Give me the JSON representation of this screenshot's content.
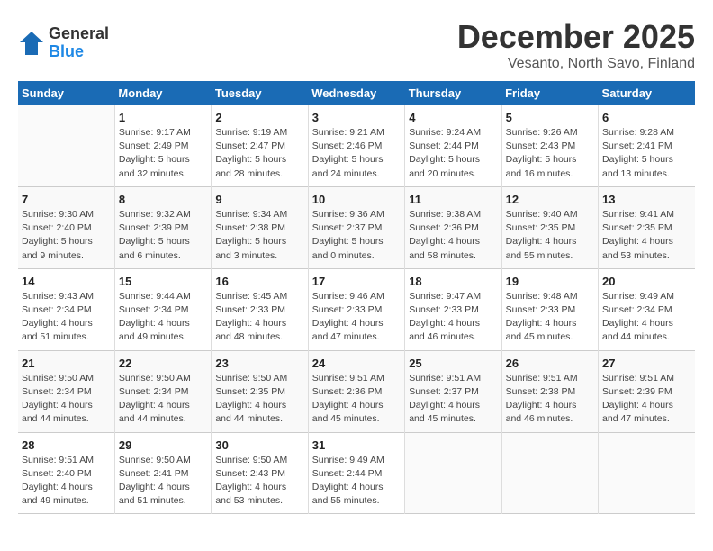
{
  "header": {
    "logo_general": "General",
    "logo_blue": "Blue",
    "month_title": "December 2025",
    "location": "Vesanto, North Savo, Finland"
  },
  "weekdays": [
    "Sunday",
    "Monday",
    "Tuesday",
    "Wednesday",
    "Thursday",
    "Friday",
    "Saturday"
  ],
  "weeks": [
    [
      {
        "day": "",
        "info": ""
      },
      {
        "day": "1",
        "info": "Sunrise: 9:17 AM\nSunset: 2:49 PM\nDaylight: 5 hours\nand 32 minutes."
      },
      {
        "day": "2",
        "info": "Sunrise: 9:19 AM\nSunset: 2:47 PM\nDaylight: 5 hours\nand 28 minutes."
      },
      {
        "day": "3",
        "info": "Sunrise: 9:21 AM\nSunset: 2:46 PM\nDaylight: 5 hours\nand 24 minutes."
      },
      {
        "day": "4",
        "info": "Sunrise: 9:24 AM\nSunset: 2:44 PM\nDaylight: 5 hours\nand 20 minutes."
      },
      {
        "day": "5",
        "info": "Sunrise: 9:26 AM\nSunset: 2:43 PM\nDaylight: 5 hours\nand 16 minutes."
      },
      {
        "day": "6",
        "info": "Sunrise: 9:28 AM\nSunset: 2:41 PM\nDaylight: 5 hours\nand 13 minutes."
      }
    ],
    [
      {
        "day": "7",
        "info": "Sunrise: 9:30 AM\nSunset: 2:40 PM\nDaylight: 5 hours\nand 9 minutes."
      },
      {
        "day": "8",
        "info": "Sunrise: 9:32 AM\nSunset: 2:39 PM\nDaylight: 5 hours\nand 6 minutes."
      },
      {
        "day": "9",
        "info": "Sunrise: 9:34 AM\nSunset: 2:38 PM\nDaylight: 5 hours\nand 3 minutes."
      },
      {
        "day": "10",
        "info": "Sunrise: 9:36 AM\nSunset: 2:37 PM\nDaylight: 5 hours\nand 0 minutes."
      },
      {
        "day": "11",
        "info": "Sunrise: 9:38 AM\nSunset: 2:36 PM\nDaylight: 4 hours\nand 58 minutes."
      },
      {
        "day": "12",
        "info": "Sunrise: 9:40 AM\nSunset: 2:35 PM\nDaylight: 4 hours\nand 55 minutes."
      },
      {
        "day": "13",
        "info": "Sunrise: 9:41 AM\nSunset: 2:35 PM\nDaylight: 4 hours\nand 53 minutes."
      }
    ],
    [
      {
        "day": "14",
        "info": "Sunrise: 9:43 AM\nSunset: 2:34 PM\nDaylight: 4 hours\nand 51 minutes."
      },
      {
        "day": "15",
        "info": "Sunrise: 9:44 AM\nSunset: 2:34 PM\nDaylight: 4 hours\nand 49 minutes."
      },
      {
        "day": "16",
        "info": "Sunrise: 9:45 AM\nSunset: 2:33 PM\nDaylight: 4 hours\nand 48 minutes."
      },
      {
        "day": "17",
        "info": "Sunrise: 9:46 AM\nSunset: 2:33 PM\nDaylight: 4 hours\nand 47 minutes."
      },
      {
        "day": "18",
        "info": "Sunrise: 9:47 AM\nSunset: 2:33 PM\nDaylight: 4 hours\nand 46 minutes."
      },
      {
        "day": "19",
        "info": "Sunrise: 9:48 AM\nSunset: 2:33 PM\nDaylight: 4 hours\nand 45 minutes."
      },
      {
        "day": "20",
        "info": "Sunrise: 9:49 AM\nSunset: 2:34 PM\nDaylight: 4 hours\nand 44 minutes."
      }
    ],
    [
      {
        "day": "21",
        "info": "Sunrise: 9:50 AM\nSunset: 2:34 PM\nDaylight: 4 hours\nand 44 minutes."
      },
      {
        "day": "22",
        "info": "Sunrise: 9:50 AM\nSunset: 2:34 PM\nDaylight: 4 hours\nand 44 minutes."
      },
      {
        "day": "23",
        "info": "Sunrise: 9:50 AM\nSunset: 2:35 PM\nDaylight: 4 hours\nand 44 minutes."
      },
      {
        "day": "24",
        "info": "Sunrise: 9:51 AM\nSunset: 2:36 PM\nDaylight: 4 hours\nand 45 minutes."
      },
      {
        "day": "25",
        "info": "Sunrise: 9:51 AM\nSunset: 2:37 PM\nDaylight: 4 hours\nand 45 minutes."
      },
      {
        "day": "26",
        "info": "Sunrise: 9:51 AM\nSunset: 2:38 PM\nDaylight: 4 hours\nand 46 minutes."
      },
      {
        "day": "27",
        "info": "Sunrise: 9:51 AM\nSunset: 2:39 PM\nDaylight: 4 hours\nand 47 minutes."
      }
    ],
    [
      {
        "day": "28",
        "info": "Sunrise: 9:51 AM\nSunset: 2:40 PM\nDaylight: 4 hours\nand 49 minutes."
      },
      {
        "day": "29",
        "info": "Sunrise: 9:50 AM\nSunset: 2:41 PM\nDaylight: 4 hours\nand 51 minutes."
      },
      {
        "day": "30",
        "info": "Sunrise: 9:50 AM\nSunset: 2:43 PM\nDaylight: 4 hours\nand 53 minutes."
      },
      {
        "day": "31",
        "info": "Sunrise: 9:49 AM\nSunset: 2:44 PM\nDaylight: 4 hours\nand 55 minutes."
      },
      {
        "day": "",
        "info": ""
      },
      {
        "day": "",
        "info": ""
      },
      {
        "day": "",
        "info": ""
      }
    ]
  ]
}
